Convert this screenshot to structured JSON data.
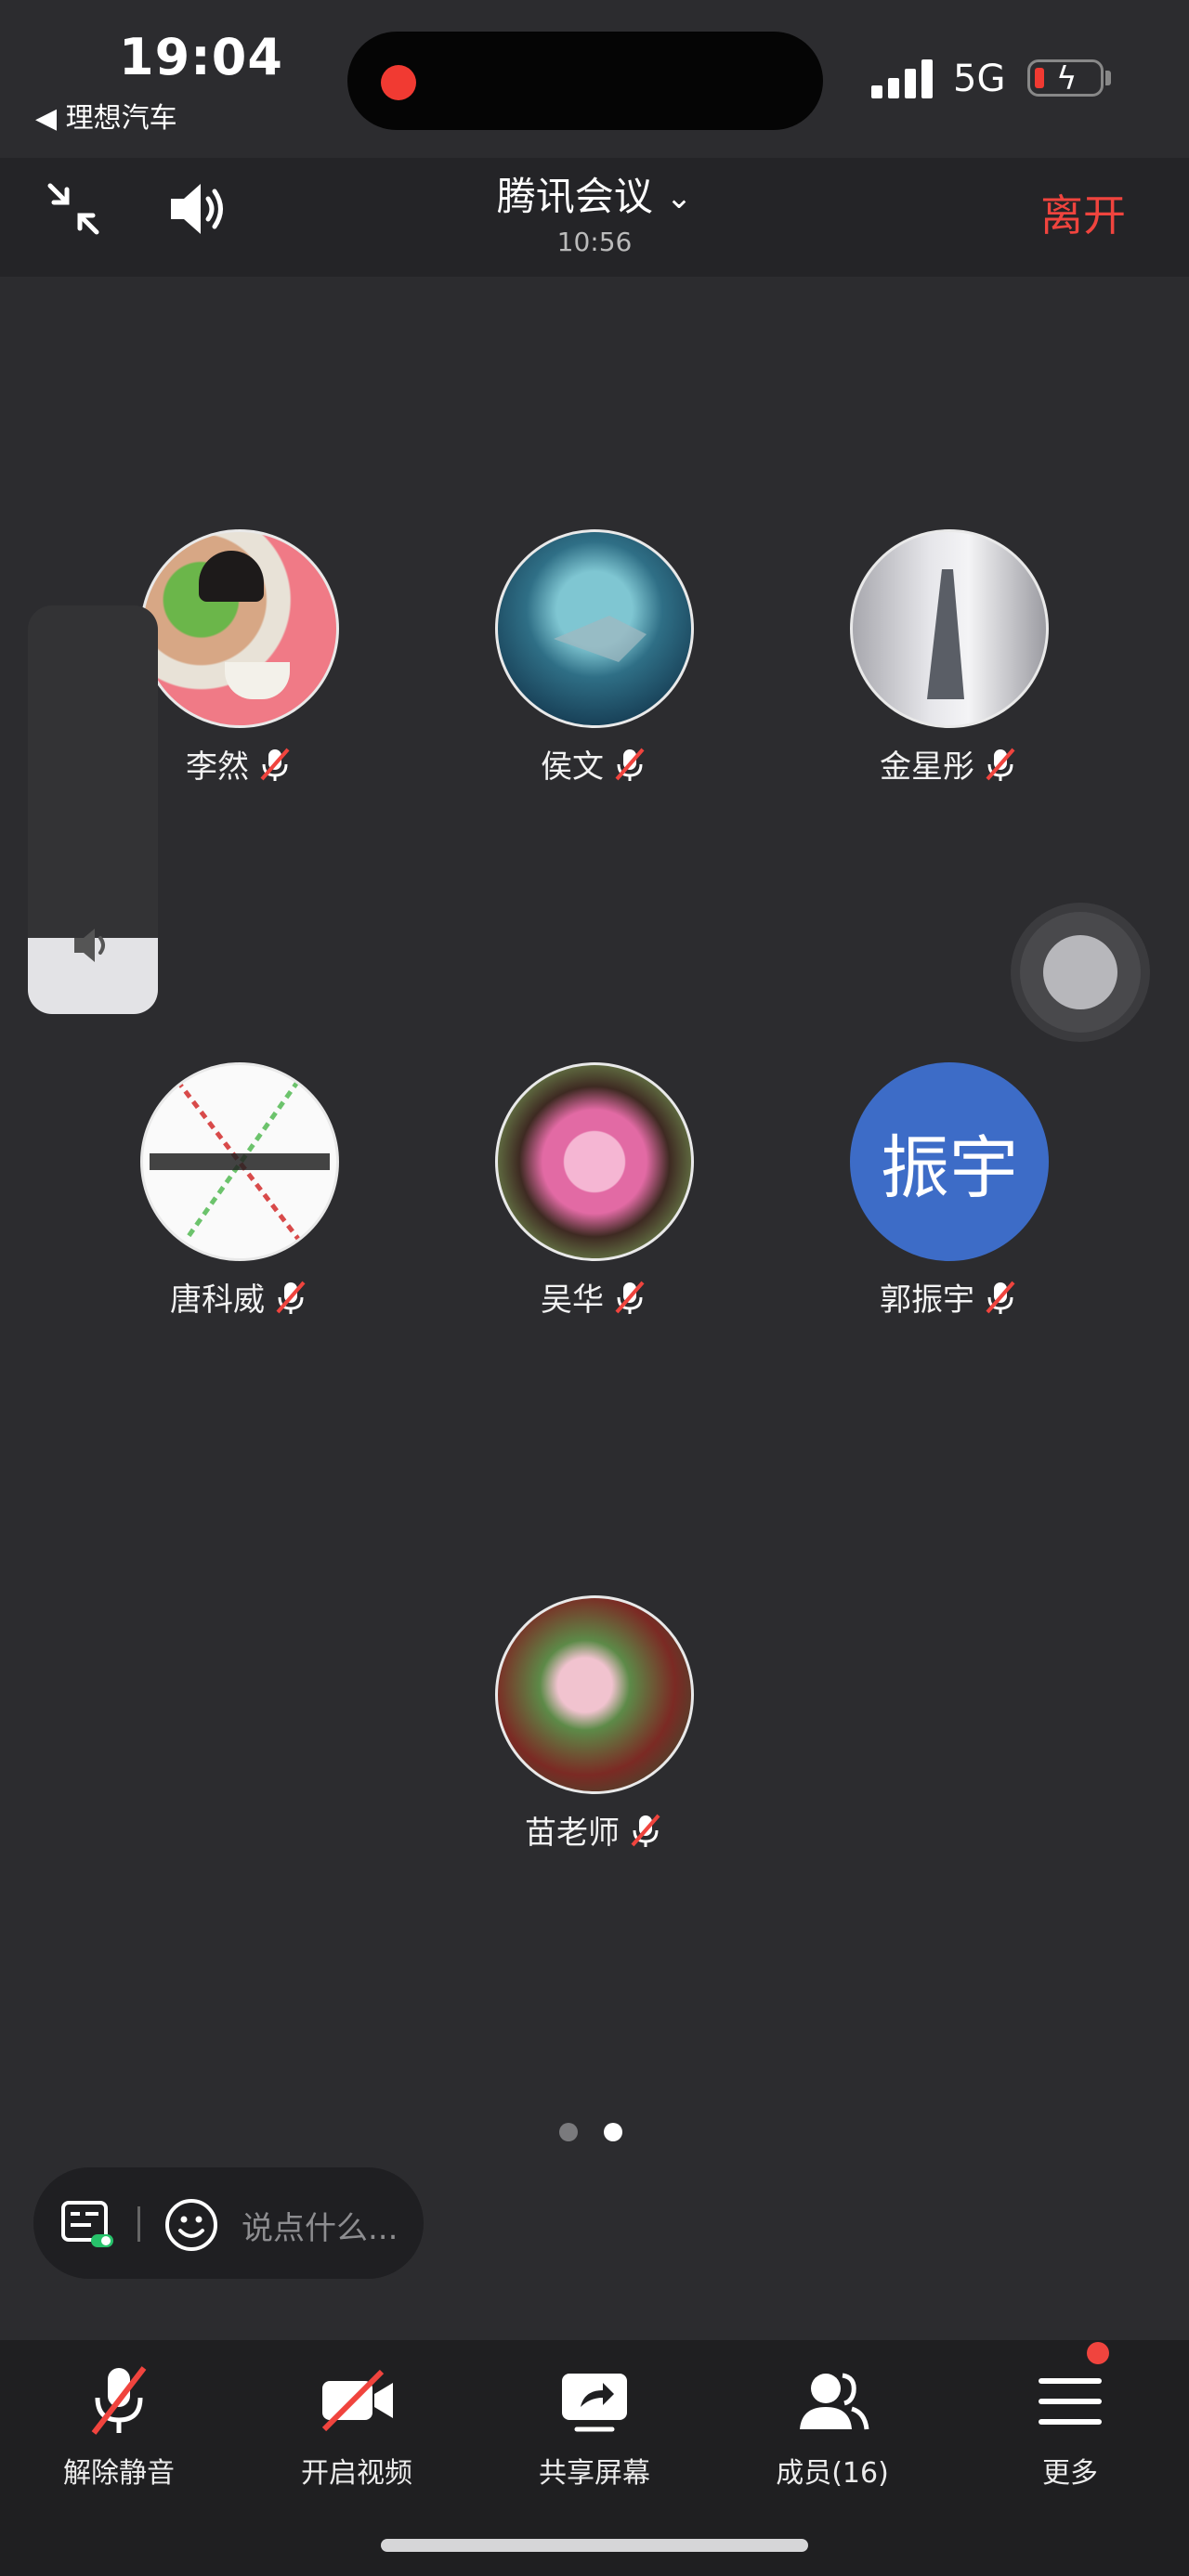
{
  "status": {
    "time": "19:04",
    "back_app": "◀ 理想汽车",
    "network": "5G"
  },
  "header": {
    "title": "腾讯会议",
    "duration": "10:56",
    "leave_label": "离开"
  },
  "participants": [
    {
      "name": "李然",
      "avatar_type": "photo-child",
      "muted": true
    },
    {
      "name": "侯文",
      "avatar_type": "photo-sea",
      "muted": true
    },
    {
      "name": "金星彤",
      "avatar_type": "photo-figure",
      "muted": true
    },
    {
      "name": "唐科威",
      "avatar_type": "photo-sketch",
      "muted": true
    },
    {
      "name": "吴华",
      "avatar_type": "photo-flower",
      "muted": true
    },
    {
      "name": "郭振宇",
      "avatar_type": "text",
      "avatar_text": "振宇",
      "avatar_color": "#3d6cc7",
      "muted": true
    },
    {
      "name": "苗老师",
      "avatar_type": "photo-blossom",
      "muted": true
    }
  ],
  "pagination": {
    "pages": 2,
    "current": 2
  },
  "chat": {
    "placeholder": "说点什么..."
  },
  "toolbar": [
    {
      "label": "解除静音",
      "icon": "mic-muted-icon"
    },
    {
      "label": "开启视频",
      "icon": "video-off-icon"
    },
    {
      "label": "共享屏幕",
      "icon": "share-screen-icon"
    },
    {
      "label": "成员(16)",
      "icon": "members-icon"
    },
    {
      "label": "更多",
      "icon": "more-menu-icon"
    }
  ],
  "colors": {
    "accent_red": "#f0443e",
    "background": "#2c2c2f",
    "toolbar": "#1f1f21"
  }
}
